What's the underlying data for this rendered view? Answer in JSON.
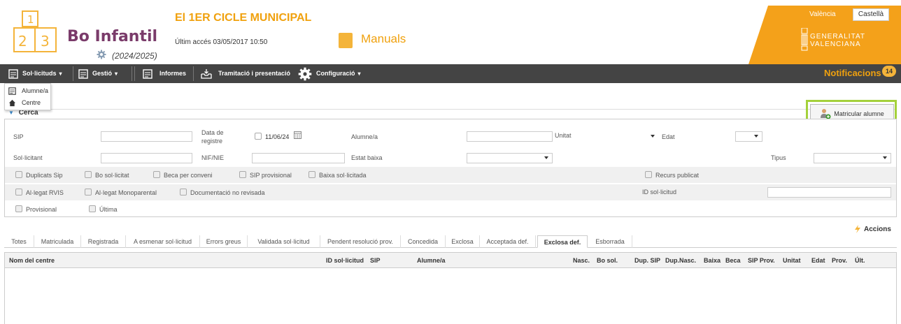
{
  "header": {
    "brand_name": "Bo Infantil",
    "brand_year": "(2024/2025)",
    "cycle_title": "El 1ER CICLE MUNICIPAL",
    "last_access": "Últim accés 03/05/2017 10:50",
    "manuals_label": "Manuals",
    "lang_valencia": "València",
    "lang_castella": "Castellà",
    "gva_line1": "GENERALITAT",
    "gva_line2": "VALENCIANA",
    "logo_digits": [
      "1",
      "2",
      "3"
    ]
  },
  "navbar": {
    "items": [
      "Sol·licituds",
      "Gestió",
      "Informes",
      "Tramitació i presentació",
      "Configuració"
    ],
    "notifications_label": "Notificacions",
    "notifications_count": "14"
  },
  "dropdown": {
    "items": [
      "Alumne/a",
      "Centre"
    ]
  },
  "toolbar": {
    "enroll_label": "Matricular alumne"
  },
  "search": {
    "title": "Cerca",
    "sip_label": "SIP",
    "registration_date_label": "Data de registre",
    "registration_date_value": "11/06/24",
    "student_label": "Alumne/a",
    "unit_label": "Unitat",
    "age_label": "Edat",
    "applicant_label": "Sol·licitant",
    "nif_label": "NIF/NIE",
    "status_low_label": "Estat baixa",
    "type_label": "Tipus",
    "checkboxes": {
      "dup_sip": "Duplicats Sip",
      "bo_sol": "Bo sol·licitat",
      "beca": "Beca per conveni",
      "sip_prov": "SIP provisional",
      "baixa_sol": "Baixa sol·licitada",
      "recurs": "Recurs publicat",
      "rvis": "Al·legat RVIS",
      "monoparental": "Al·legat Monoparental",
      "doc_no_rev": "Documentació no revisada",
      "provisional": "Provisional",
      "ultima": "Última"
    },
    "request_id_label": "ID sol·licitud"
  },
  "results": {
    "actions_label": "Accions",
    "tabs": [
      "Totes",
      "Matriculada",
      "Registrada",
      "A esmenar sol·licitud",
      "Errors greus",
      "Validada sol·licitud",
      "Pendent resolució prov.",
      "Concedida",
      "Exclosa",
      "Acceptada def.",
      "Exclosa def.",
      "Esborrada"
    ],
    "active_tab": "Exclosa def.",
    "columns": [
      "Nom del centre",
      "ID sol·licitud",
      "SIP",
      "Alumne/a",
      "Nasc.",
      "Bo sol.",
      "Dup. SIP",
      "Dup.Nasc.",
      "Baixa",
      "Beca",
      "SIP Prov.",
      "Unitat",
      "Edat",
      "Prov.",
      "Últ."
    ]
  },
  "colors": {
    "accent_orange": "#f0a10e",
    "brand_purple": "#7a3b6a",
    "nav_dark": "#444444",
    "highlight_green": "#a4d13b"
  }
}
